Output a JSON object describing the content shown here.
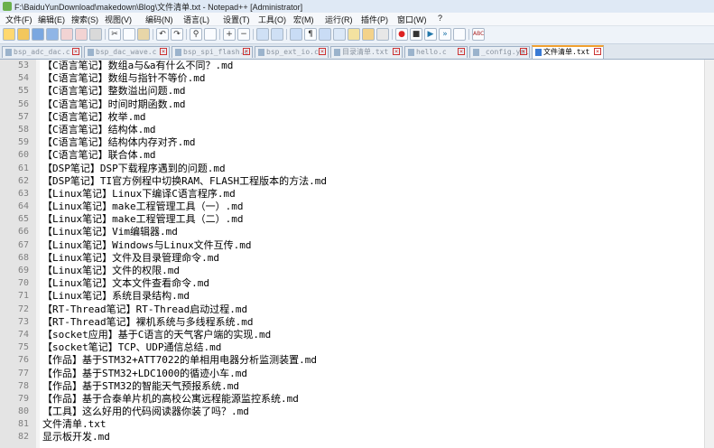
{
  "window": {
    "title": "F:\\BaiduYunDownload\\makedown\\Blog\\文件清单.txt - Notepad++ [Administrator]"
  },
  "menu": [
    "文件(F)",
    "编辑(E)",
    "搜索(S)",
    "视图(V)",
    "编码(N)",
    "语言(L)",
    "设置(T)",
    "工具(O)",
    "宏(M)",
    "运行(R)",
    "插件(P)",
    "窗口(W)",
    "?"
  ],
  "toolbar_icons": [
    "new-file-icon",
    "open-file-icon",
    "save-icon",
    "save-all-icon",
    "close-icon",
    "close-all-icon",
    "print-icon",
    "cut-icon",
    "copy-icon",
    "paste-icon",
    "undo-icon",
    "redo-icon",
    "find-icon",
    "replace-icon",
    "zoom-in-icon",
    "zoom-out-icon",
    "sync-v-icon",
    "sync-h-icon",
    "word-wrap-icon",
    "show-all-chars-icon",
    "indent-guide-icon",
    "doc-map-icon",
    "function-list-icon",
    "folder-workspace-icon",
    "monitor-icon",
    "record-macro-icon",
    "stop-macro-icon",
    "play-macro-icon",
    "run-macro-multiple-icon",
    "save-macro-icon",
    "spell-check-icon"
  ],
  "tabs": [
    {
      "label": "bsp_adc_dac.c",
      "active": false
    },
    {
      "label": "bsp_dac_wave.c",
      "active": false
    },
    {
      "label": "bsp_spi_flash.c",
      "active": false
    },
    {
      "label": "bsp_ext_io.c",
      "active": false
    },
    {
      "label": "目录清单.txt",
      "active": false
    },
    {
      "label": "hello.c",
      "active": false
    },
    {
      "label": "_config.yml",
      "active": false
    },
    {
      "label": "文件清单.txt",
      "active": true
    }
  ],
  "editor": {
    "lines": [
      {
        "n": "53",
        "text": "【C语言笔记】数组a与&a有什么不同？.md"
      },
      {
        "n": "54",
        "text": "【C语言笔记】数组与指针不等价.md"
      },
      {
        "n": "55",
        "text": "【C语言笔记】整数溢出问题.md"
      },
      {
        "n": "56",
        "text": "【C语言笔记】时间时期函数.md"
      },
      {
        "n": "57",
        "text": "【C语言笔记】枚举.md"
      },
      {
        "n": "58",
        "text": "【C语言笔记】结构体.md"
      },
      {
        "n": "59",
        "text": "【C语言笔记】结构体内存对齐.md"
      },
      {
        "n": "60",
        "text": "【C语言笔记】联合体.md"
      },
      {
        "n": "61",
        "text": "【DSP笔记】DSP下载程序遇到的问题.md"
      },
      {
        "n": "62",
        "text": "【DSP笔记】TI官方例程中切换RAM、FLASH工程版本的方法.md"
      },
      {
        "n": "63",
        "text": "【Linux笔记】Linux下编译C语言程序.md"
      },
      {
        "n": "64",
        "text": "【Linux笔记】make工程管理工具（一）.md"
      },
      {
        "n": "65",
        "text": "【Linux笔记】make工程管理工具（二）.md"
      },
      {
        "n": "66",
        "text": "【Linux笔记】Vim编辑器.md"
      },
      {
        "n": "67",
        "text": "【Linux笔记】Windows与Linux文件互传.md"
      },
      {
        "n": "68",
        "text": "【Linux笔记】文件及目录管理命令.md"
      },
      {
        "n": "69",
        "text": "【Linux笔记】文件的权限.md"
      },
      {
        "n": "70",
        "text": "【Linux笔记】文本文件查看命令.md"
      },
      {
        "n": "71",
        "text": "【Linux笔记】系统目录结构.md"
      },
      {
        "n": "72",
        "text": "【RT-Thread笔记】RT-Thread启动过程.md"
      },
      {
        "n": "73",
        "text": "【RT-Thread笔记】裸机系统与多线程系统.md"
      },
      {
        "n": "74",
        "text": "【socket应用】基于C语言的天气客户端的实现.md"
      },
      {
        "n": "75",
        "text": "【socket笔记】TCP、UDP通信总结.md"
      },
      {
        "n": "76",
        "text": "【作品】基于STM32+ATT7022的单相用电器分析监测装置.md"
      },
      {
        "n": "77",
        "text": "【作品】基于STM32+LDC1000的循迹小车.md"
      },
      {
        "n": "78",
        "text": "【作品】基于STM32的智能天气预报系统.md"
      },
      {
        "n": "79",
        "text": "【作品】基于合泰单片机的高校公寓远程能源监控系统.md"
      },
      {
        "n": "80",
        "text": "【工具】这么好用的代码阅读器你装了吗？.md"
      },
      {
        "n": "81",
        "text": "文件清单.txt"
      },
      {
        "n": "82",
        "text": "显示板开发.md"
      }
    ]
  }
}
